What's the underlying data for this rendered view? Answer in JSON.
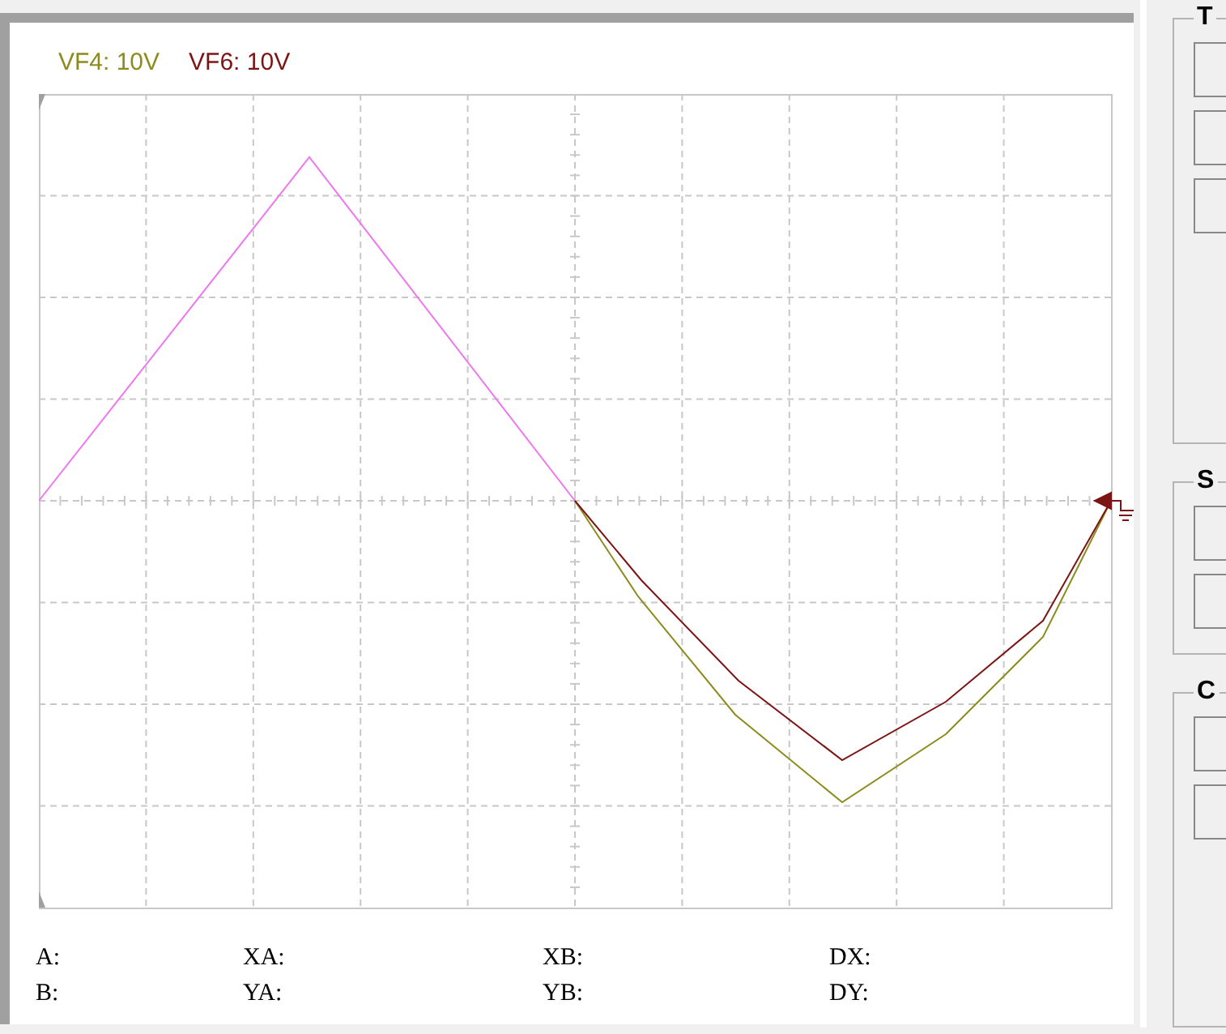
{
  "scope": {
    "channels": [
      {
        "label": "VF4: 10V",
        "color": "#8c8c1e"
      },
      {
        "label": "VF6: 10V",
        "color": "#7d1414"
      }
    ],
    "readouts": [
      {
        "cells": [
          "A:",
          "XA:",
          "XB:",
          "DX:"
        ]
      },
      {
        "cells": [
          "B:",
          "YA:",
          "YB:",
          "DY:"
        ]
      }
    ]
  },
  "side_groups": [
    {
      "title": "T"
    },
    {
      "title": "S"
    },
    {
      "title": "C"
    }
  ]
}
